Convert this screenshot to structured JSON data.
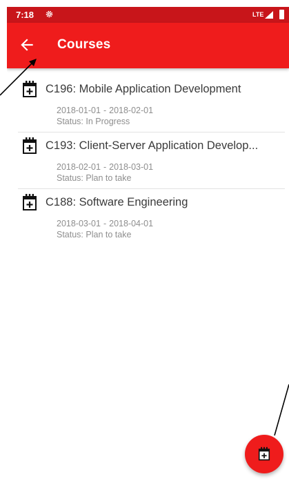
{
  "status_bar": {
    "time": "7:18",
    "network": "LTE",
    "icons": [
      "gear-icon",
      "signal-icon",
      "battery-icon"
    ]
  },
  "app_bar": {
    "title": "Courses",
    "back_icon": "arrow-left-icon"
  },
  "courses": [
    {
      "title": "C196: Mobile Application Development",
      "start": "2018-01-01",
      "end": "2018-02-01",
      "status": "Status: In Progress",
      "icon": "calendar-plus-icon"
    },
    {
      "title": "C193: Client-Server Application Develop...",
      "start": "2018-02-01",
      "end": "2018-03-01",
      "status": "Status: Plan to take",
      "icon": "calendar-plus-icon"
    },
    {
      "title": "C188: Software Engineering",
      "start": "2018-03-01",
      "end": "2018-04-01",
      "status": "Status: Plan to take",
      "icon": "calendar-plus-icon"
    }
  ],
  "date_separator": "-",
  "fab": {
    "icon": "calendar-plus-icon"
  },
  "colors": {
    "status_bar": "#c8151a",
    "app_bar": "#ef1c1c",
    "fab": "#ef1c1c",
    "title_text": "#3a3a3a",
    "secondary_text": "#8e8e8e"
  }
}
